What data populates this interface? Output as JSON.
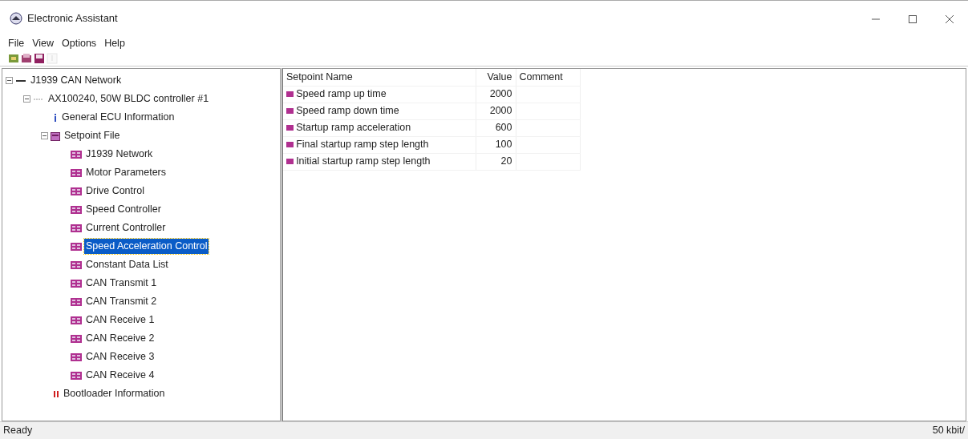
{
  "window": {
    "title": "Electronic Assistant"
  },
  "menu": [
    "File",
    "View",
    "Options",
    "Help"
  ],
  "toolbar": [
    {
      "kind": "network",
      "disabled": false
    },
    {
      "kind": "open",
      "disabled": false
    },
    {
      "kind": "save",
      "disabled": false
    },
    {
      "kind": "flash",
      "disabled": true
    }
  ],
  "tree": [
    {
      "label": "J1939 CAN Network",
      "kind": "network",
      "expanded": true,
      "selected": false,
      "children": [
        {
          "label": "AX100240, 50W BLDC controller #1",
          "kind": "ecu",
          "expanded": true,
          "selected": false,
          "children": [
            {
              "label": "General ECU Information",
              "kind": "info",
              "selected": false
            },
            {
              "label": "Setpoint File",
              "kind": "file",
              "expanded": true,
              "selected": false,
              "children": [
                {
                  "label": "J1939 Network",
                  "kind": "sp",
                  "selected": false
                },
                {
                  "label": "Motor Parameters",
                  "kind": "sp",
                  "selected": false
                },
                {
                  "label": "Drive Control",
                  "kind": "sp",
                  "selected": false
                },
                {
                  "label": "Speed Controller",
                  "kind": "sp",
                  "selected": false
                },
                {
                  "label": "Current Controller",
                  "kind": "sp",
                  "selected": false
                },
                {
                  "label": "Speed Acceleration Control",
                  "kind": "sp",
                  "selected": true
                },
                {
                  "label": "Constant Data List",
                  "kind": "sp",
                  "selected": false
                },
                {
                  "label": "CAN Transmit 1",
                  "kind": "sp",
                  "selected": false
                },
                {
                  "label": "CAN Transmit 2",
                  "kind": "sp",
                  "selected": false
                },
                {
                  "label": "CAN Receive 1",
                  "kind": "sp",
                  "selected": false
                },
                {
                  "label": "CAN Receive 2",
                  "kind": "sp",
                  "selected": false
                },
                {
                  "label": "CAN Receive 3",
                  "kind": "sp",
                  "selected": false
                },
                {
                  "label": "CAN Receive 4",
                  "kind": "sp",
                  "selected": false
                }
              ]
            },
            {
              "label": "Bootloader Information",
              "kind": "boot",
              "selected": false
            }
          ]
        }
      ]
    }
  ],
  "table": {
    "columns": [
      "Setpoint Name",
      "Value",
      "Comment"
    ],
    "rows": [
      {
        "name": "Speed ramp up time",
        "value": "2000"
      },
      {
        "name": "Speed ramp down time",
        "value": "2000"
      },
      {
        "name": "Startup ramp acceleration",
        "value": "600"
      },
      {
        "name": "Final startup ramp step length",
        "value": "100"
      },
      {
        "name": "Initial startup ramp step length",
        "value": "20"
      }
    ]
  },
  "status_bar": {
    "text": "Ready",
    "rate": "50 kbit/"
  }
}
